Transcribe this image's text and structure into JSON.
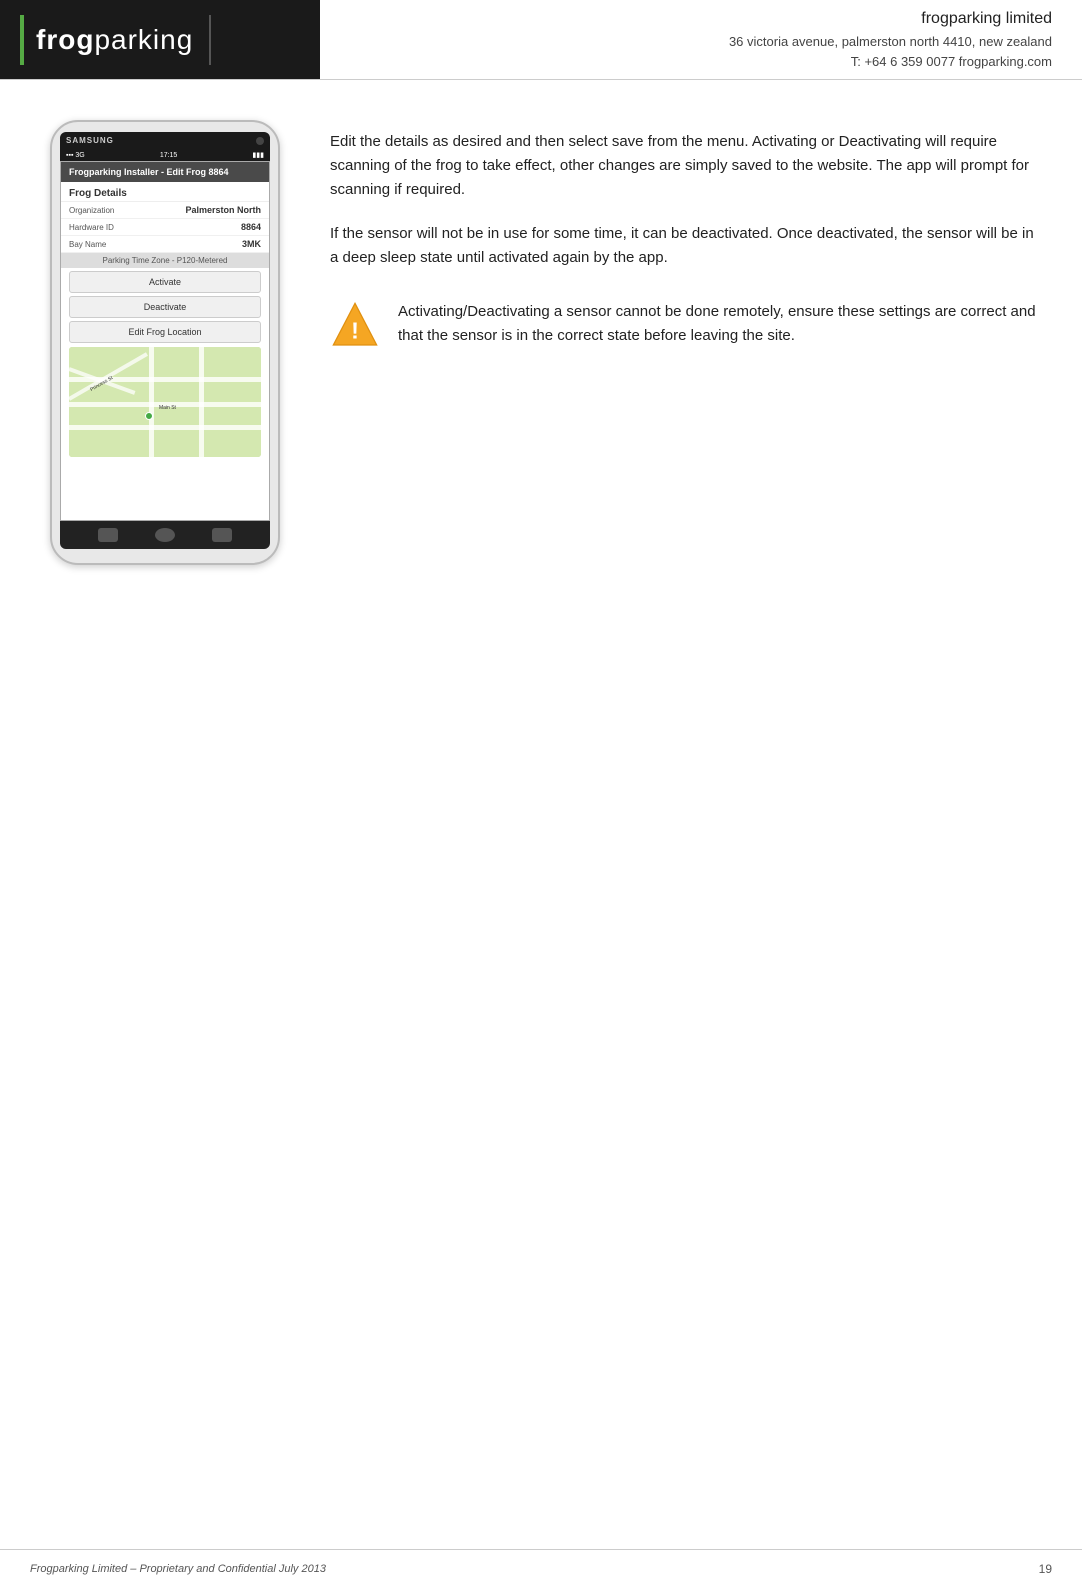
{
  "header": {
    "logo_frog": "frog",
    "logo_parking": "parking",
    "company_name": "frogparking limited",
    "address": "36 victoria avenue, palmerston north 4410, new zealand",
    "contact": "T: +64 6 359 0077  frogparking.com"
  },
  "phone": {
    "brand": "SAMSUNG",
    "status_bar": "17:15",
    "app_bar_title": "Frogparking Installer - Edit Frog 8864",
    "section_title": "Frog Details",
    "row_org_label": "Organization",
    "row_org_value": "Palmerston North",
    "row_hw_label": "Hardware ID",
    "row_hw_value": "8864",
    "row_bay_label": "Bay Name",
    "row_bay_value": "3MK",
    "parking_zone": "Parking Time Zone - P120-Metered",
    "activate_btn": "Activate",
    "deactivate_btn": "Deactivate",
    "edit_location_btn": "Edit Frog Location"
  },
  "content": {
    "paragraph1": "Edit the details as desired and then select save from the menu. Activating or Deactivating will require scanning of the frog to take effect, other changes are simply saved to the website. The app will prompt for scanning if required.",
    "paragraph2": "If the sensor will not be in use for some time, it can be deactivated. Once deactivated, the sensor will be in a deep sleep state until activated again by the app.",
    "warning_text": "Activating/Deactivating a sensor cannot be done remotely, ensure these settings are correct and that the sensor is in the correct state before leaving the site."
  },
  "footer": {
    "left": "Frogparking Limited – Proprietary and Confidential July 2013",
    "right": "19"
  }
}
